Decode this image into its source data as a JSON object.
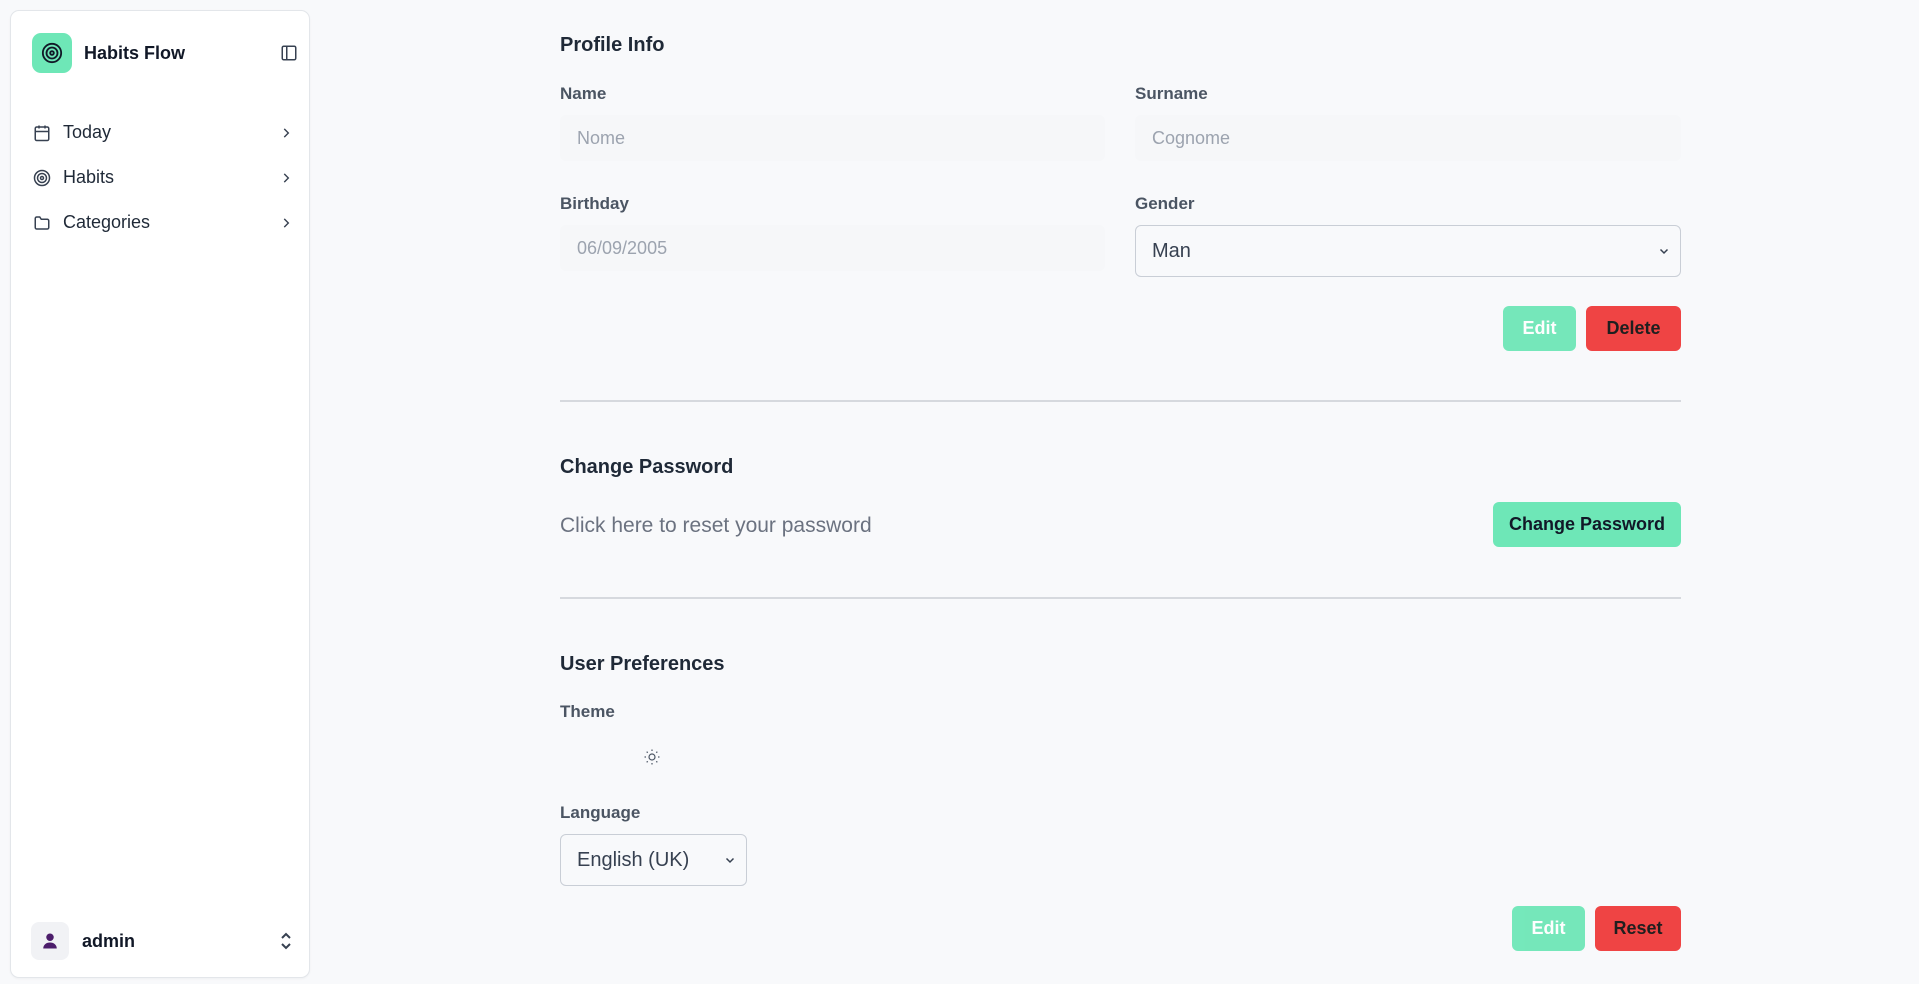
{
  "app": {
    "name": "Habits Flow"
  },
  "colors": {
    "accent": "#6ee7b7",
    "danger": "#ef4444",
    "background": "#f8f9fb"
  },
  "sidebar": {
    "items": [
      {
        "label": "Today",
        "icon": "calendar-icon"
      },
      {
        "label": "Habits",
        "icon": "target-icon"
      },
      {
        "label": "Categories",
        "icon": "folder-icon"
      }
    ],
    "user": {
      "name": "admin",
      "icon": "user-icon"
    }
  },
  "profile": {
    "title": "Profile Info",
    "name_label": "Name",
    "name_placeholder": "Nome",
    "surname_label": "Surname",
    "surname_placeholder": "Cognome",
    "birthday_label": "Birthday",
    "birthday_value": "06/09/2005",
    "gender_label": "Gender",
    "gender_value": "Man",
    "edit_label": "Edit",
    "delete_label": "Delete"
  },
  "password": {
    "title": "Change Password",
    "helper": "Click here to reset your password",
    "button_label": "Change Password"
  },
  "preferences": {
    "title": "User Preferences",
    "theme_label": "Theme",
    "theme_icon": "sun-icon",
    "language_label": "Language",
    "language_value": "English (UK)",
    "edit_label": "Edit",
    "reset_label": "Reset"
  }
}
